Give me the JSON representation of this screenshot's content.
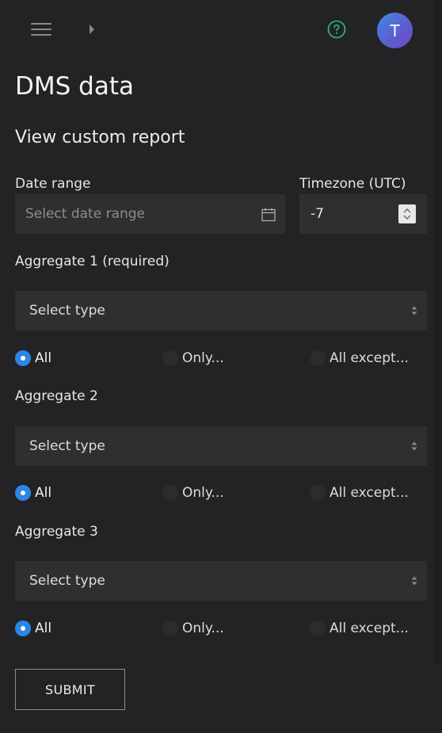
{
  "header": {
    "menu_icon": "hamburger-menu-icon",
    "expand_icon": "caret-right-icon",
    "help_icon": "help-circle-icon",
    "avatar_initial": "T",
    "accent_help_color": "#2bbf8a",
    "avatar_gradient": [
      "#3d8ae0",
      "#7048c7"
    ]
  },
  "page": {
    "title": "DMS data",
    "subtitle": "View custom report"
  },
  "date_range": {
    "label": "Date range",
    "placeholder": "Select date range",
    "value": "",
    "icon": "calendar-icon"
  },
  "timezone": {
    "label": "Timezone (UTC)",
    "value": "-7"
  },
  "aggregates": [
    {
      "label": "Aggregate 1 (required)",
      "select_value": "Select type",
      "options": [
        "All",
        "Only...",
        "All except..."
      ],
      "selected": "All"
    },
    {
      "label": "Aggregate 2",
      "select_value": "Select type",
      "options": [
        "All",
        "Only...",
        "All except..."
      ],
      "selected": "All"
    },
    {
      "label": "Aggregate 3",
      "select_value": "Select type",
      "options": [
        "All",
        "Only...",
        "All except..."
      ],
      "selected": "All"
    }
  ],
  "submit_label": "SUBMIT",
  "colors": {
    "background": "#232325",
    "field": "#2f2f31",
    "radio_selected": "#2b86e6"
  }
}
